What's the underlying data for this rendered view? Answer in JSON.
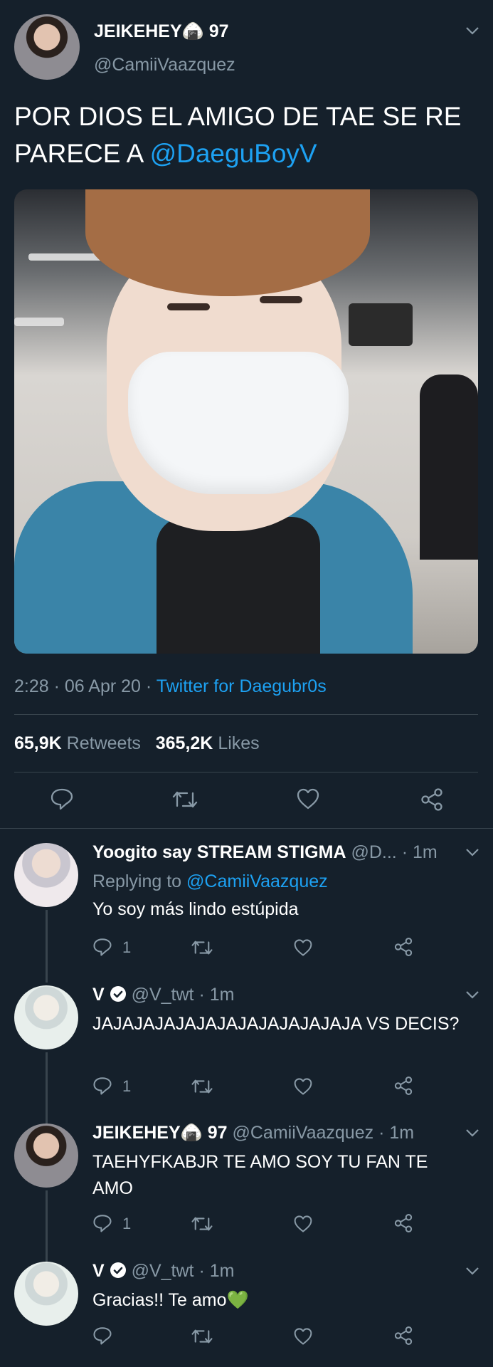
{
  "main_tweet": {
    "display_name": "JEIKEHEY🍙 97",
    "handle": "@CamiiVaazquez",
    "text_prefix": "POR DIOS EL AMIGO DE TAE SE RE PARECE A ",
    "mention": "@DaeguBoyV",
    "time": "2:28",
    "date": "06 Apr 20",
    "client": "Twitter for Daegubr0s",
    "retweets_count": "65,9K",
    "retweets_label": "Retweets",
    "likes_count": "365,2K",
    "likes_label": "Likes",
    "separator": "·"
  },
  "replies": [
    {
      "display_name": "Yoogito say STREAM STIGMA",
      "handle": "@D...",
      "time": "1m",
      "replying_label": "Replying to",
      "replying_to": "@CamiiVaazquez",
      "text": "Yo soy más lindo estúpida",
      "reply_count": "1"
    },
    {
      "display_name": "V",
      "handle": "@V_twt",
      "time": "1m",
      "text": "JAJAJAJAJAJAJAJAJAJAJAJAJA VS DECIS?",
      "reply_count": "1"
    },
    {
      "display_name": "JEIKEHEY🍙 97",
      "handle": "@CamiiVaazquez",
      "time": "1m",
      "text": "TAEHYFKABJR TE AMO SOY TU FAN TE AMO",
      "reply_count": "1"
    },
    {
      "display_name": "V",
      "handle": "@V_twt",
      "time": "1m",
      "text": "Gracias!! Te amo💚",
      "reply_count": ""
    }
  ],
  "colors": {
    "background": "#15202b",
    "muted": "#8899a6",
    "link": "#1da1f2",
    "divider": "#38444d"
  }
}
